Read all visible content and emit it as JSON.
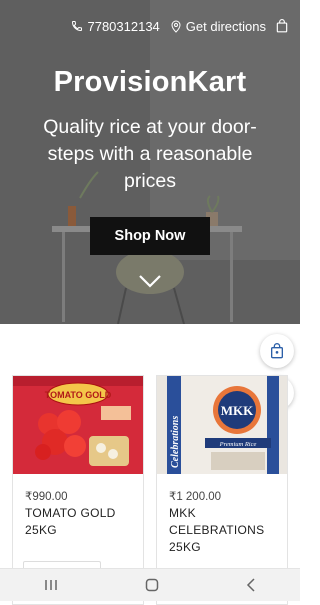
{
  "header": {
    "phone": "7780312134",
    "directions_label": "Get directions"
  },
  "hero": {
    "brand": "ProvisionKart",
    "tagline": "Quality rice at your door-steps with a reasonable prices",
    "cta_label": "Shop Now"
  },
  "products": [
    {
      "price": "₹990.00",
      "name_line1": "TOMATO GOLD",
      "name_line2": "25KG",
      "package_text": "TOMATO GOLD"
    },
    {
      "price": "₹1 200.00",
      "name_line1": "MKK",
      "name_line2": "CELEBRATIONS",
      "name_line3": "25KG",
      "package_text_logo": "MKK",
      "package_text_side": "Celebrations",
      "package_text_band": "Premium Rice"
    }
  ],
  "colors": {
    "hero_overlay": "#666666",
    "cta_bg": "#111111",
    "text_white": "#ffffff"
  }
}
